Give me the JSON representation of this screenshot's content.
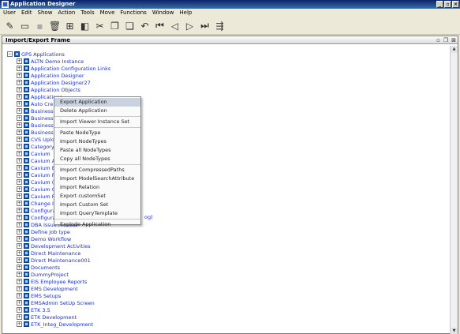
{
  "window": {
    "title": "Application Designer"
  },
  "menubar": [
    "User",
    "Edit",
    "Show",
    "Action",
    "Tools",
    "Move",
    "Functions",
    "Window",
    "Help"
  ],
  "frame": {
    "title": "Import/Export Frame"
  },
  "tree": {
    "root": "GPS Applications",
    "items": [
      "ALTN Demo Instance",
      "Application Configuration Links",
      "Application Designer",
      "Application Designer27",
      "Application Objects",
      "Applications",
      "Auto Cre",
      "Business",
      "Business",
      "Business",
      "Business",
      "CVS Uplo",
      "Category",
      "Cavium",
      "Cavium A",
      "Cavium E",
      "Cavium F",
      "Cavium (",
      "Cavium C",
      "Cavium F",
      "Change I",
      "Configura",
      "Configura",
      "DBA Issue Process",
      "Define Job type",
      "Demo Workflow",
      "Development Activities",
      "Direct Maintenance",
      "Direct Maintenance001",
      "Documents",
      "DummyProject",
      "EIS Employee Reports",
      "EMS Development",
      "EMS Setups",
      "EMSAdmin SetUp Screen",
      "ETK 3.5",
      "ETK Development",
      "ETK_Integ_Development"
    ],
    "partial_text_behind_menu": "og)"
  },
  "context_menu": {
    "groups": [
      [
        "Export Application",
        "Delete Application"
      ],
      [
        "Import Viewer Instance Set"
      ],
      [
        "Paste NodeType",
        "Import NodeTypes",
        "Paste all NodeTypes",
        "Copy all NodeTypes"
      ],
      [
        "Import CompressedPaths",
        "Import ModelSearchAttribute",
        "Import Relation",
        "Export customSet",
        "Import Custom Set",
        "Import QueryTemplate"
      ],
      [
        "Explode Application"
      ]
    ],
    "highlighted": "Export Application"
  }
}
